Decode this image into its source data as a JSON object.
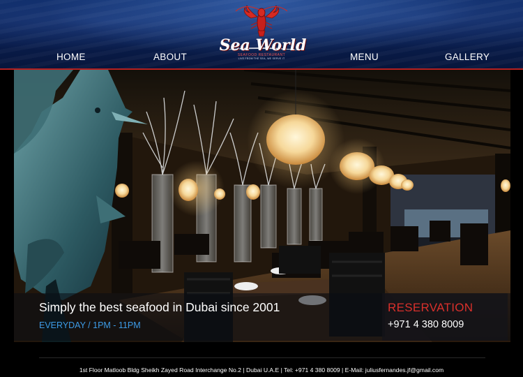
{
  "nav": {
    "home": "HOME",
    "about": "ABOUT",
    "menu": "MENU",
    "gallery": "GALLERY"
  },
  "logo": {
    "name": "Sea World",
    "subtitle": "SEAFOOD RESTAURANT",
    "motto": "LIVE FROM THE SEA, WE SERVE IT"
  },
  "hero": {
    "tagline": "Simply the best seafood in Dubai since 2001",
    "hours": "EVERYDAY / 1PM - 11PM"
  },
  "reservation": {
    "title": "RESERVATION",
    "phone": "+971 4 380 8009"
  },
  "footer": {
    "address": "1st Floor Matloob Bldg Sheikh Zayed Road Interchange No.2 | Dubai U.A.E | Tel: +971 4 380 8009 | E-Mail: juliusfernandes.jf@gmail.com"
  },
  "colors": {
    "header_blue": "#0a1f52",
    "accent_red": "#d9302b",
    "hours_blue": "#3d9be6"
  }
}
